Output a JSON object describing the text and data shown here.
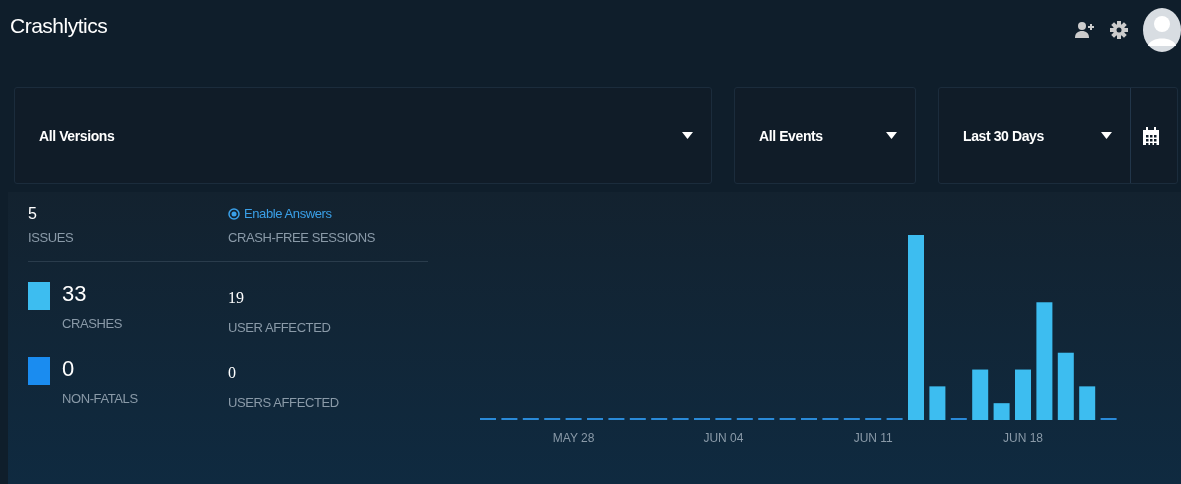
{
  "header": {
    "title": "Crashlytics"
  },
  "filters": [
    {
      "label": "All Versions",
      "kind": "wide"
    },
    {
      "label": "All Events",
      "kind": "narrow"
    },
    {
      "label": "Last 30 Days",
      "kind": "date"
    }
  ],
  "summary": {
    "issues": {
      "value": "5",
      "label": "ISSUES"
    },
    "answers": {
      "link": "Enable Answers",
      "label": "CRASH-FREE SESSIONS"
    }
  },
  "metrics": [
    {
      "value": "33",
      "label": "CRASHES",
      "color": "#3dbdf0",
      "users_value": "19",
      "users_label": "USER AFFECTED"
    },
    {
      "value": "0",
      "label": "NON-FATALS",
      "color": "#1a8cf0",
      "users_value": "0",
      "users_label": "USERS AFFECTED"
    }
  ],
  "chart": {
    "date_labels": [
      "MAY 28",
      "JUN 04",
      "JUN 11",
      "JUN 18"
    ]
  }
}
